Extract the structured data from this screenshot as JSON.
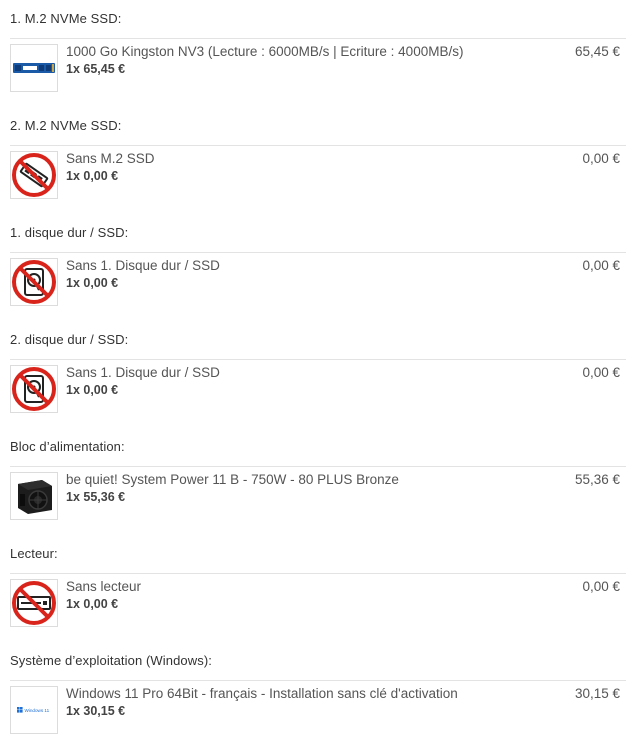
{
  "sections": [
    {
      "title": "1. M.2 NVMe SSD:",
      "thumb_icon": "ssd-m2-photo-icon",
      "name": "1000 Go Kingston NV3 (Lecture : 6000MB/s | Ecriture : 4000MB/s)",
      "qty": "1x 65,45 €",
      "price": "65,45 €"
    },
    {
      "title": "2. M.2 NVMe SSD:",
      "thumb_icon": "no-m2-ssd-icon",
      "name": "Sans M.2 SSD",
      "qty": "1x 0,00 €",
      "price": "0,00 €"
    },
    {
      "title": "1. disque dur / SSD:",
      "thumb_icon": "no-hard-disk-icon",
      "name": "Sans 1. Disque dur / SSD",
      "qty": "1x 0,00 €",
      "price": "0,00 €"
    },
    {
      "title": "2. disque dur / SSD:",
      "thumb_icon": "no-hard-disk-icon",
      "name": "Sans 1. Disque dur / SSD",
      "qty": "1x 0,00 €",
      "price": "0,00 €"
    },
    {
      "title": "Bloc d’alimentation:",
      "thumb_icon": "power-supply-photo-icon",
      "name": "be quiet! System Power 11 B - 750W - 80 PLUS Bronze",
      "qty": "1x 55,36 €",
      "price": "55,36 €"
    },
    {
      "title": "Lecteur:",
      "thumb_icon": "no-optical-drive-icon",
      "name": "Sans lecteur",
      "qty": "1x 0,00 €",
      "price": "0,00 €"
    },
    {
      "title": "Système d’exploitation (Windows):",
      "thumb_icon": "windows-11-box-icon",
      "name": "Windows 11 Pro 64Bit - français - Installation sans clé d'activation",
      "qty": "1x 30,15 €",
      "price": "30,15 €",
      "thumb_caption": "Windows 11"
    }
  ],
  "colors": {
    "forbidden_red": "#d9241b",
    "ssd_blue": "#1a5aa6",
    "windows_blue": "#1e6fd6",
    "divider": "#e3e3e3"
  }
}
